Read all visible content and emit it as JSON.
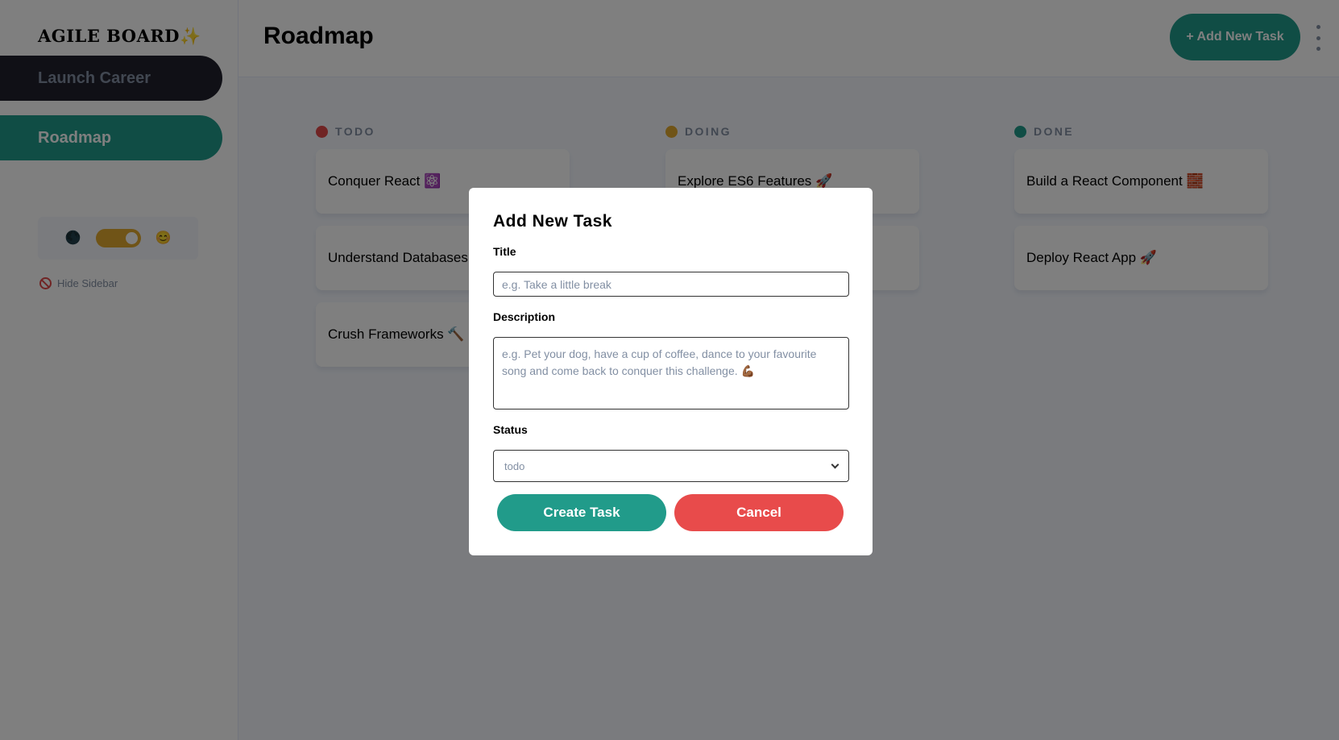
{
  "app": {
    "logo": "AGILE BOARD✨"
  },
  "sidebar": {
    "boards": [
      {
        "label": "Launch Career"
      },
      {
        "label": "Roadmap"
      }
    ],
    "theme": {
      "dark_icon": "🌑",
      "light_icon": "😊"
    },
    "hide_label": "Hide Sidebar"
  },
  "header": {
    "title": "Roadmap",
    "add_button": "+ Add New Task"
  },
  "columns": [
    {
      "name": "TODO",
      "color": "#e04848",
      "tasks": [
        {
          "title": "Conquer React ⚛️"
        },
        {
          "title": "Understand Databases 📅"
        },
        {
          "title": "Crush Frameworks 🔨"
        }
      ]
    },
    {
      "name": "DOING",
      "color": "#e0a82e",
      "tasks": [
        {
          "title": "Explore ES6 Features 🚀"
        },
        {
          "title": ""
        }
      ]
    },
    {
      "name": "DONE",
      "color": "#219b8a",
      "tasks": [
        {
          "title": "Build a React Component 🧱"
        },
        {
          "title": "Deploy React App 🚀"
        }
      ]
    }
  ],
  "modal": {
    "title": "Add New Task",
    "title_label": "Title",
    "title_value": "",
    "title_placeholder": "e.g. Take a little break",
    "description_label": "Description",
    "description_value": "",
    "description_placeholder": "e.g. Pet your dog, have a cup of coffee, dance to your favourite song and come back to conquer this challenge. 💪🏾",
    "status_label": "Status",
    "status_value": "todo",
    "create_button": "Create Task",
    "cancel_button": "Cancel"
  },
  "colors": {
    "accent": "#219b8a",
    "danger": "#e84b4b",
    "warning": "#e0a82e"
  }
}
